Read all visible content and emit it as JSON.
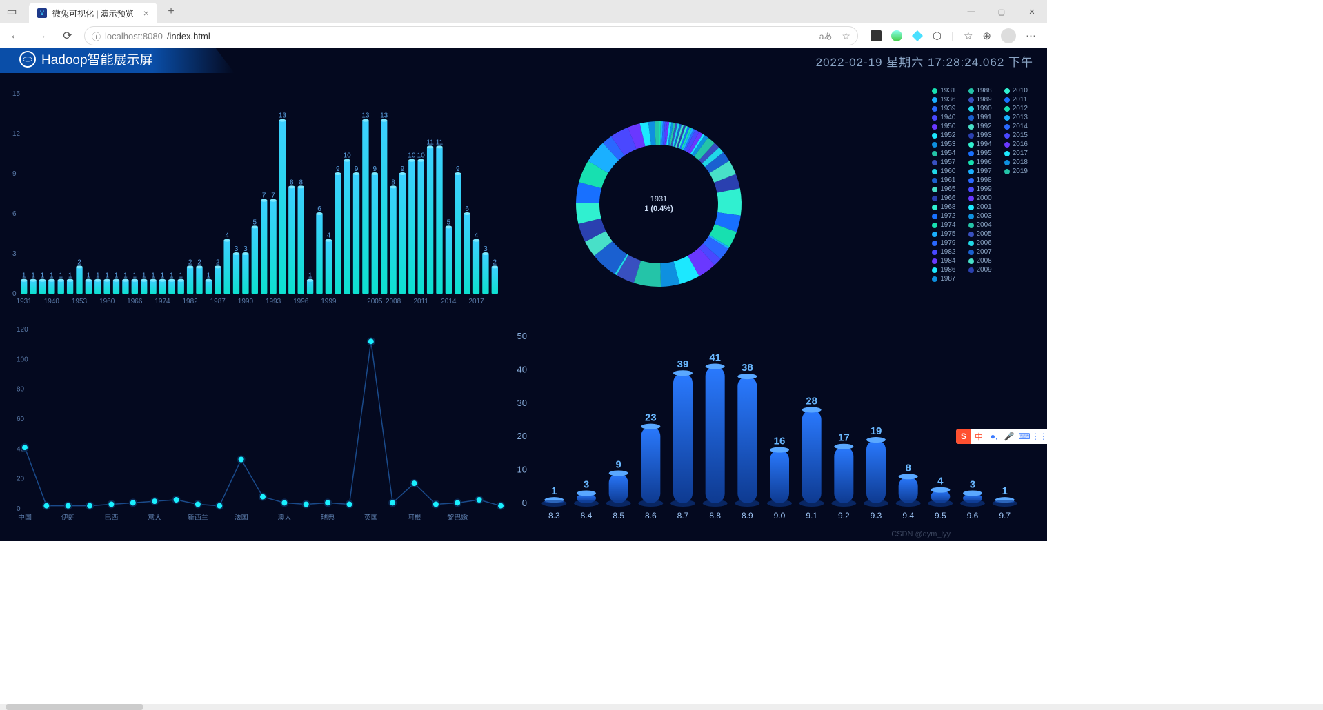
{
  "browser": {
    "tab_title": "微兔可视化 | 演示预览",
    "url_host": "localhost:8080",
    "url_path": "/index.html"
  },
  "dashboard": {
    "title": "Hadoop智能展示屏",
    "datetime": "2022-02-19 星期六 17:28:24.062 下午",
    "watermark": "CSDN @dym_lyy",
    "donut_center_line1": "1931",
    "donut_center_line2": "1 (0.4%)"
  },
  "chart_data": [
    {
      "id": "year-bar",
      "type": "bar",
      "ylim": [
        0,
        15
      ],
      "yticks": [
        0,
        3,
        6,
        9,
        12,
        15
      ],
      "categories": [
        "1931",
        "1936",
        "1939",
        "1940",
        "1950",
        "1952",
        "1953",
        "1954",
        "1957",
        "1960",
        "1961",
        "1965",
        "1966",
        "1968",
        "1972",
        "1974",
        "1975",
        "1979",
        "1982",
        "1984",
        "1986",
        "1987",
        "1988",
        "1989",
        "1990",
        "1991",
        "1992",
        "1993",
        "1994",
        "1995",
        "1996",
        "1997",
        "1998",
        "1999",
        "2000",
        "2001",
        "2003",
        "2004",
        "2005",
        "2007",
        "2008",
        "2009",
        "2010",
        "2011",
        "2012",
        "2013",
        "2014",
        "2015",
        "2016",
        "2017",
        "2018",
        "2019"
      ],
      "values": [
        1,
        1,
        1,
        1,
        1,
        1,
        2,
        1,
        1,
        1,
        1,
        1,
        1,
        1,
        1,
        1,
        1,
        1,
        2,
        2,
        1,
        2,
        4,
        3,
        3,
        5,
        7,
        7,
        13,
        8,
        8,
        1,
        6,
        4,
        9,
        10,
        9,
        13,
        9,
        13,
        8,
        9,
        10,
        10,
        11,
        11,
        5,
        9,
        6,
        4,
        3,
        2
      ],
      "xtick_labels": [
        "1931",
        "1940",
        "1953",
        "1960",
        "1966",
        "1974",
        "1982",
        "1987",
        "1990",
        "1993",
        "1996",
        "1999",
        "2005",
        "2008",
        "2011",
        "2014",
        "2017"
      ]
    },
    {
      "id": "year-donut",
      "type": "pie",
      "series": [
        {
          "name": "1931",
          "value": 1
        },
        {
          "name": "1936",
          "value": 1
        },
        {
          "name": "1939",
          "value": 1
        },
        {
          "name": "1940",
          "value": 1
        },
        {
          "name": "1950",
          "value": 1
        },
        {
          "name": "1952",
          "value": 1
        },
        {
          "name": "1953",
          "value": 1
        },
        {
          "name": "1954",
          "value": 1
        },
        {
          "name": "1957",
          "value": 1
        },
        {
          "name": "1960",
          "value": 1
        },
        {
          "name": "1961",
          "value": 1
        },
        {
          "name": "1965",
          "value": 1
        },
        {
          "name": "1966",
          "value": 1
        },
        {
          "name": "1968",
          "value": 1
        },
        {
          "name": "1972",
          "value": 1
        },
        {
          "name": "1974",
          "value": 1
        },
        {
          "name": "1975",
          "value": 1
        },
        {
          "name": "1979",
          "value": 1
        },
        {
          "name": "1982",
          "value": 2
        },
        {
          "name": "1984",
          "value": 2
        },
        {
          "name": "1986",
          "value": 1
        },
        {
          "name": "1987",
          "value": 2
        },
        {
          "name": "1988",
          "value": 4
        },
        {
          "name": "1989",
          "value": 3
        },
        {
          "name": "1990",
          "value": 3
        },
        {
          "name": "1991",
          "value": 5
        },
        {
          "name": "1992",
          "value": 7
        },
        {
          "name": "1993",
          "value": 7
        },
        {
          "name": "1994",
          "value": 13
        },
        {
          "name": "1995",
          "value": 8
        },
        {
          "name": "1996",
          "value": 8
        },
        {
          "name": "1997",
          "value": 1
        },
        {
          "name": "1998",
          "value": 6
        },
        {
          "name": "1999",
          "value": 4
        },
        {
          "name": "2000",
          "value": 9
        },
        {
          "name": "2001",
          "value": 10
        },
        {
          "name": "2003",
          "value": 9
        },
        {
          "name": "2004",
          "value": 13
        },
        {
          "name": "2005",
          "value": 9
        },
        {
          "name": "2006",
          "value": 1
        },
        {
          "name": "2007",
          "value": 13
        },
        {
          "name": "2008",
          "value": 8
        },
        {
          "name": "2009",
          "value": 9
        },
        {
          "name": "2010",
          "value": 10
        },
        {
          "name": "2011",
          "value": 10
        },
        {
          "name": "2012",
          "value": 11
        },
        {
          "name": "2013",
          "value": 11
        },
        {
          "name": "2014",
          "value": 5
        },
        {
          "name": "2015",
          "value": 9
        },
        {
          "name": "2016",
          "value": 6
        },
        {
          "name": "2017",
          "value": 4
        },
        {
          "name": "2018",
          "value": 3
        },
        {
          "name": "2019",
          "value": 2
        }
      ],
      "legend_cols": [
        [
          "1931",
          "1936",
          "1939",
          "1940",
          "1950",
          "1952",
          "1953",
          "1954",
          "1957",
          "1960",
          "1961",
          "1965",
          "1966",
          "1968",
          "1972",
          "1974",
          "1975",
          "1979",
          "1982",
          "1984",
          "1986",
          "1987"
        ],
        [
          "1988",
          "1989",
          "1990",
          "1991",
          "1992",
          "1993",
          "1994",
          "1995",
          "1996",
          "1997",
          "1998",
          "1999",
          "2000",
          "2001",
          "2003",
          "2004",
          "2005",
          "2006",
          "2007",
          "2008",
          "2009"
        ],
        [
          "2010",
          "2011",
          "2012",
          "2013",
          "2014",
          "2015",
          "2016",
          "2017",
          "2018",
          "2019"
        ]
      ]
    },
    {
      "id": "country-line",
      "type": "line",
      "ylim": [
        0,
        120
      ],
      "yticks": [
        0,
        20,
        40,
        60,
        80,
        100,
        120
      ],
      "categories": [
        "中国",
        "",
        "伊朗",
        "",
        "巴西",
        "",
        "意大",
        "",
        "新西兰",
        "",
        "法国",
        "",
        "澳大",
        "",
        "瑞典",
        "",
        "英国",
        "",
        "阿根",
        "",
        "黎巴嫩"
      ],
      "values": [
        41,
        2,
        2,
        2,
        3,
        4,
        5,
        6,
        3,
        2,
        33,
        8,
        4,
        3,
        4,
        3,
        112,
        4,
        17,
        3,
        4,
        6,
        2
      ]
    },
    {
      "id": "rating-bar",
      "type": "bar",
      "ylim": [
        0,
        50
      ],
      "yticks": [
        0,
        10,
        20,
        30,
        40,
        50
      ],
      "categories": [
        "8.3",
        "8.4",
        "8.5",
        "8.6",
        "8.7",
        "8.8",
        "8.9",
        "9.0",
        "9.1",
        "9.2",
        "9.3",
        "9.4",
        "9.5",
        "9.6",
        "9.7"
      ],
      "values": [
        1,
        3,
        9,
        23,
        39,
        41,
        38,
        16,
        28,
        17,
        19,
        8,
        4,
        3,
        1
      ]
    }
  ]
}
